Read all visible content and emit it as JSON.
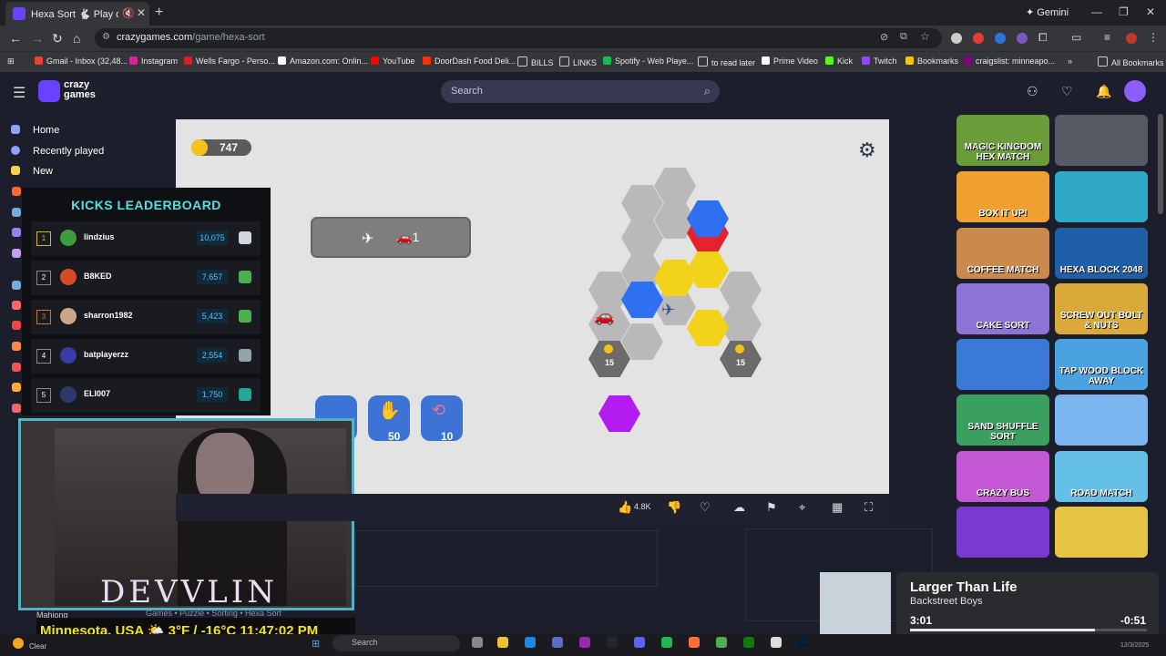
{
  "browser": {
    "tab_title": "Hexa Sort 🐇 Play on CrazyGames",
    "gemini_label": "Gemini",
    "url_host": "crazygames.com",
    "url_path": "/game/hexa-sort",
    "bookmarks": [
      "Gmail - Inbox (32,48...",
      "Instagram",
      "Wells Fargo - Perso...",
      "Amazon.com: Onlin...",
      "YouTube",
      "DoorDash Food Deli...",
      "BILLS",
      "LINKS",
      "Spotify - Web Playe...",
      "to read later",
      "Prime Video",
      "Kick",
      "Twitch",
      "Bookmarks",
      "craigslist: minneapo..."
    ],
    "all_bookmarks": "All Bookmarks"
  },
  "site": {
    "logo_line1": "crazy",
    "logo_line2": "games",
    "search_placeholder": "Search",
    "nav": [
      "Home",
      "Recently played",
      "New"
    ]
  },
  "game": {
    "coins": "747",
    "goal_count": "1",
    "locked_cells": [
      "15",
      "15"
    ],
    "powerups": [
      {
        "name": "hammer",
        "cost": ""
      },
      {
        "name": "hand-swap",
        "cost": "50"
      },
      {
        "name": "shuffle",
        "cost": "10"
      }
    ],
    "colors": {
      "blue": "#2f6ff2",
      "yellow": "#f2d21b",
      "red": "#e4232e",
      "purple": "#b21cf0",
      "gray": "#b9b9b9"
    }
  },
  "actions": {
    "likes": "4.8K"
  },
  "leaderboard": {
    "title": "KICKS LEADERBOARD",
    "rows": [
      {
        "rank": "1",
        "name": "lindzius",
        "score": "10,075"
      },
      {
        "rank": "2",
        "name": "B8KED",
        "score": "7,657"
      },
      {
        "rank": "3",
        "name": "sharron1982",
        "score": "5,423"
      },
      {
        "rank": "4",
        "name": "batplayerzz",
        "score": "2,554"
      },
      {
        "rank": "5",
        "name": "ELI007",
        "score": "1,750"
      }
    ]
  },
  "stream": {
    "name": "DEVVLIN",
    "info": "Minnesota, USA 🌤️ 3°F / -16°C 11:47:02 PM",
    "below_cam": "Mahjong",
    "breadcrumb": "Games • Puzzle • Sorting • Hexa Sort"
  },
  "thumbs": [
    {
      "label": "MAGIC KINGDOM HEX MATCH",
      "color": "#6a9c3a"
    },
    {
      "label": "",
      "color": "#555a63"
    },
    {
      "label": "BOX IT UP!",
      "color": "#f0a030"
    },
    {
      "label": "",
      "color": "#2fa7c7"
    },
    {
      "label": "COFFEE MATCH",
      "color": "#c98a4b"
    },
    {
      "label": "",
      "color": "#c47bd1"
    },
    {
      "label": "HEXA BLOCK 2048",
      "color": "#1f5fa8"
    },
    {
      "label": "CAKE SORT",
      "color": "#8d74d6"
    },
    {
      "label": "SCREW OUT BOLT & NUTS",
      "color": "#d9a93a"
    },
    {
      "label": "",
      "color": "#3a7ad6"
    },
    {
      "label": "TAP WOOD BLOCK AWAY",
      "color": "#4aa3e0"
    },
    {
      "label": "SAND SHUFFLE SORT",
      "color": "#3aa060"
    },
    {
      "label": "",
      "color": "#7bb6f0"
    },
    {
      "label": "CRAZY BUS",
      "color": "#c457d3"
    },
    {
      "label": "ROAD MATCH",
      "color": "#65c0e8"
    },
    {
      "label": "",
      "color": "#7a3ad1"
    },
    {
      "label": "",
      "color": "#e8c445"
    }
  ],
  "media": {
    "title": "Larger Than Life",
    "artist": "Backstreet Boys",
    "elapsed": "3:01",
    "remaining": "-0:51",
    "progress": 0.78
  },
  "taskbar": {
    "weather": "Clear",
    "search_placeholder": "Search",
    "date": "12/3/2025"
  }
}
